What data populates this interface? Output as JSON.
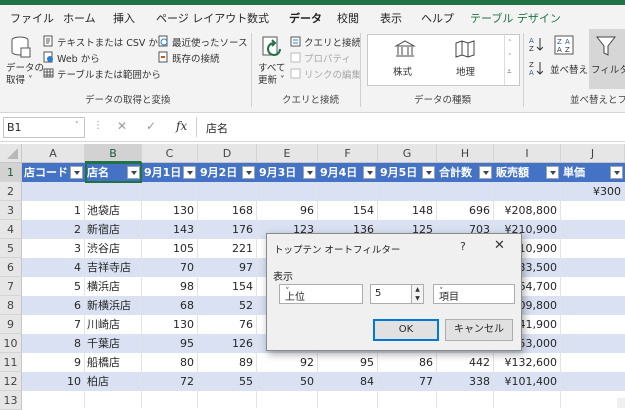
{
  "ribbon_tabs": [
    "ファイル",
    "ホーム",
    "挿入",
    "ページ レイアウト",
    "数式",
    "データ",
    "校閲",
    "表示",
    "ヘルプ",
    "テーブル デザイン"
  ],
  "active_tab": "データ",
  "ribbon": {
    "get_data": {
      "get_data_label_1": "データの",
      "get_data_label_2": "取得 ˅",
      "from_text_csv": "テキストまたは CSV から",
      "from_web": "Web から",
      "from_table": "テーブルまたは範囲から",
      "recent_sources": "最近使ったソース",
      "existing_connections": "既存の接続",
      "group_label": "データの取得と変換"
    },
    "queries": {
      "refresh_all_1": "すべて",
      "refresh_all_2": "更新 ˅",
      "queries_connections": "クエリと接続",
      "properties": "プロパティ",
      "edit_links": "リンクの編集",
      "group_label": "クエリと接続"
    },
    "data_types": {
      "stocks": "株式",
      "geography": "地理",
      "group_label": "データの種類"
    },
    "sort_filter": {
      "sort": "並べ替え",
      "filter": "フィルター",
      "group_label": "並べ替えとフィ"
    }
  },
  "formula_bar": {
    "name_box": "B1",
    "cancel_glyph": "✕",
    "enter_glyph": "✓",
    "fx": "fx",
    "content": "店名"
  },
  "columns": [
    "A",
    "B",
    "C",
    "D",
    "E",
    "F",
    "G",
    "H",
    "I",
    "J"
  ],
  "selected_column": "B",
  "rows": [
    "1",
    "2",
    "3",
    "4",
    "5",
    "6",
    "7",
    "8",
    "9",
    "10",
    "11",
    "12",
    "13"
  ],
  "table": {
    "headers": [
      "店コード",
      "店名",
      "9月1日",
      "9月2日",
      "9月3日",
      "9月4日",
      "9月5日",
      "合計数",
      "販売額",
      "単価"
    ],
    "row2_unit_price": "¥300",
    "data": [
      [
        "1",
        "池袋店",
        "130",
        "168",
        "96",
        "154",
        "148",
        "696",
        "¥208,800"
      ],
      [
        "2",
        "新宿店",
        "143",
        "176",
        "123",
        "136",
        "125",
        "703",
        "¥210,900"
      ],
      [
        "3",
        "渋谷店",
        "105",
        "221",
        "",
        "",
        "",
        "",
        "¥210,900"
      ],
      [
        "4",
        "吉祥寺店",
        "70",
        "97",
        "",
        "",
        "",
        "",
        "¥133,500"
      ],
      [
        "5",
        "横浜店",
        "98",
        "154",
        "",
        "",
        "",
        "",
        "¥164,700"
      ],
      [
        "6",
        "新横浜店",
        "68",
        "52",
        "",
        "",
        "",
        "",
        "¥109,800"
      ],
      [
        "7",
        "川崎店",
        "130",
        "76",
        "",
        "",
        "",
        "",
        "¥141,900"
      ],
      [
        "8",
        "千葉店",
        "95",
        "126",
        "",
        "",
        "",
        "",
        "¥153,000"
      ],
      [
        "9",
        "船橋店",
        "80",
        "89",
        "92",
        "95",
        "86",
        "442",
        "¥132,600"
      ],
      [
        "10",
        "柏店",
        "72",
        "55",
        "50",
        "84",
        "77",
        "338",
        "¥101,400"
      ]
    ]
  },
  "dialog": {
    "title": "トップテン オートフィルター",
    "help": "?",
    "close": "✕",
    "section_label": "表示",
    "direction_value": "上位",
    "count_value": "5",
    "unit_value": "項目",
    "ok_label": "OK",
    "cancel_label": "キャンセル"
  },
  "colors": {
    "accent": "#217346",
    "table_header": "#4472c4",
    "band": "#d9e1f2"
  }
}
